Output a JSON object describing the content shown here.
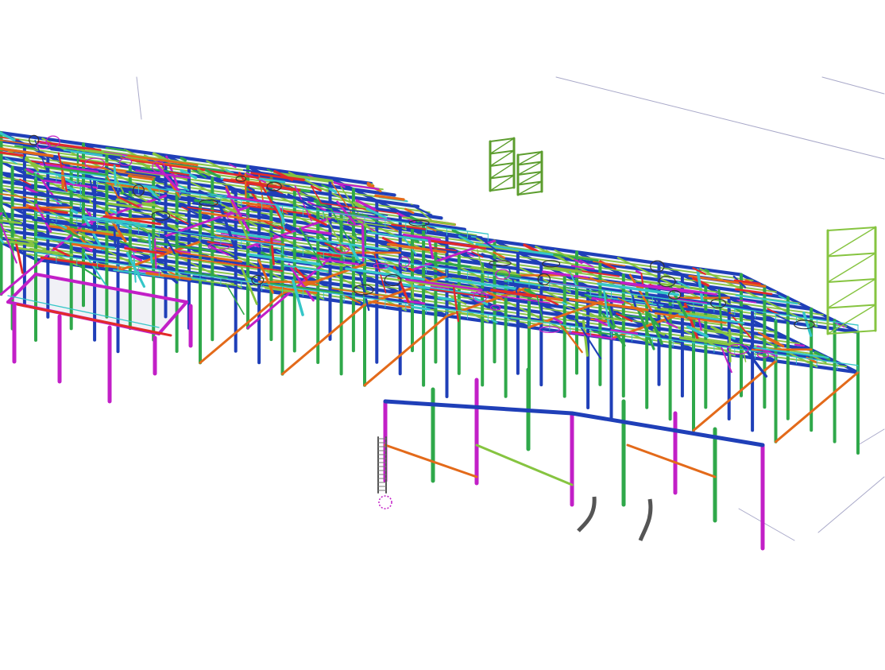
{
  "viewport": {
    "background": "#ffffff",
    "gridline_color": "#a9a9c9"
  },
  "model": {
    "type": "3D steel structure model (isometric view)",
    "member_colors": {
      "primary_beam": "#1f3fb8",
      "column": "#2fa84a",
      "secondary_beam": "#86c440",
      "bracing": "#e36a1a",
      "tertiary": "#c21fc7",
      "handrail": "#35c6c8",
      "pipe_support": "#e22a2a",
      "grating": "#6a6a6a"
    },
    "icons": [
      "origin-marker-icon",
      "ladder-icon"
    ]
  }
}
